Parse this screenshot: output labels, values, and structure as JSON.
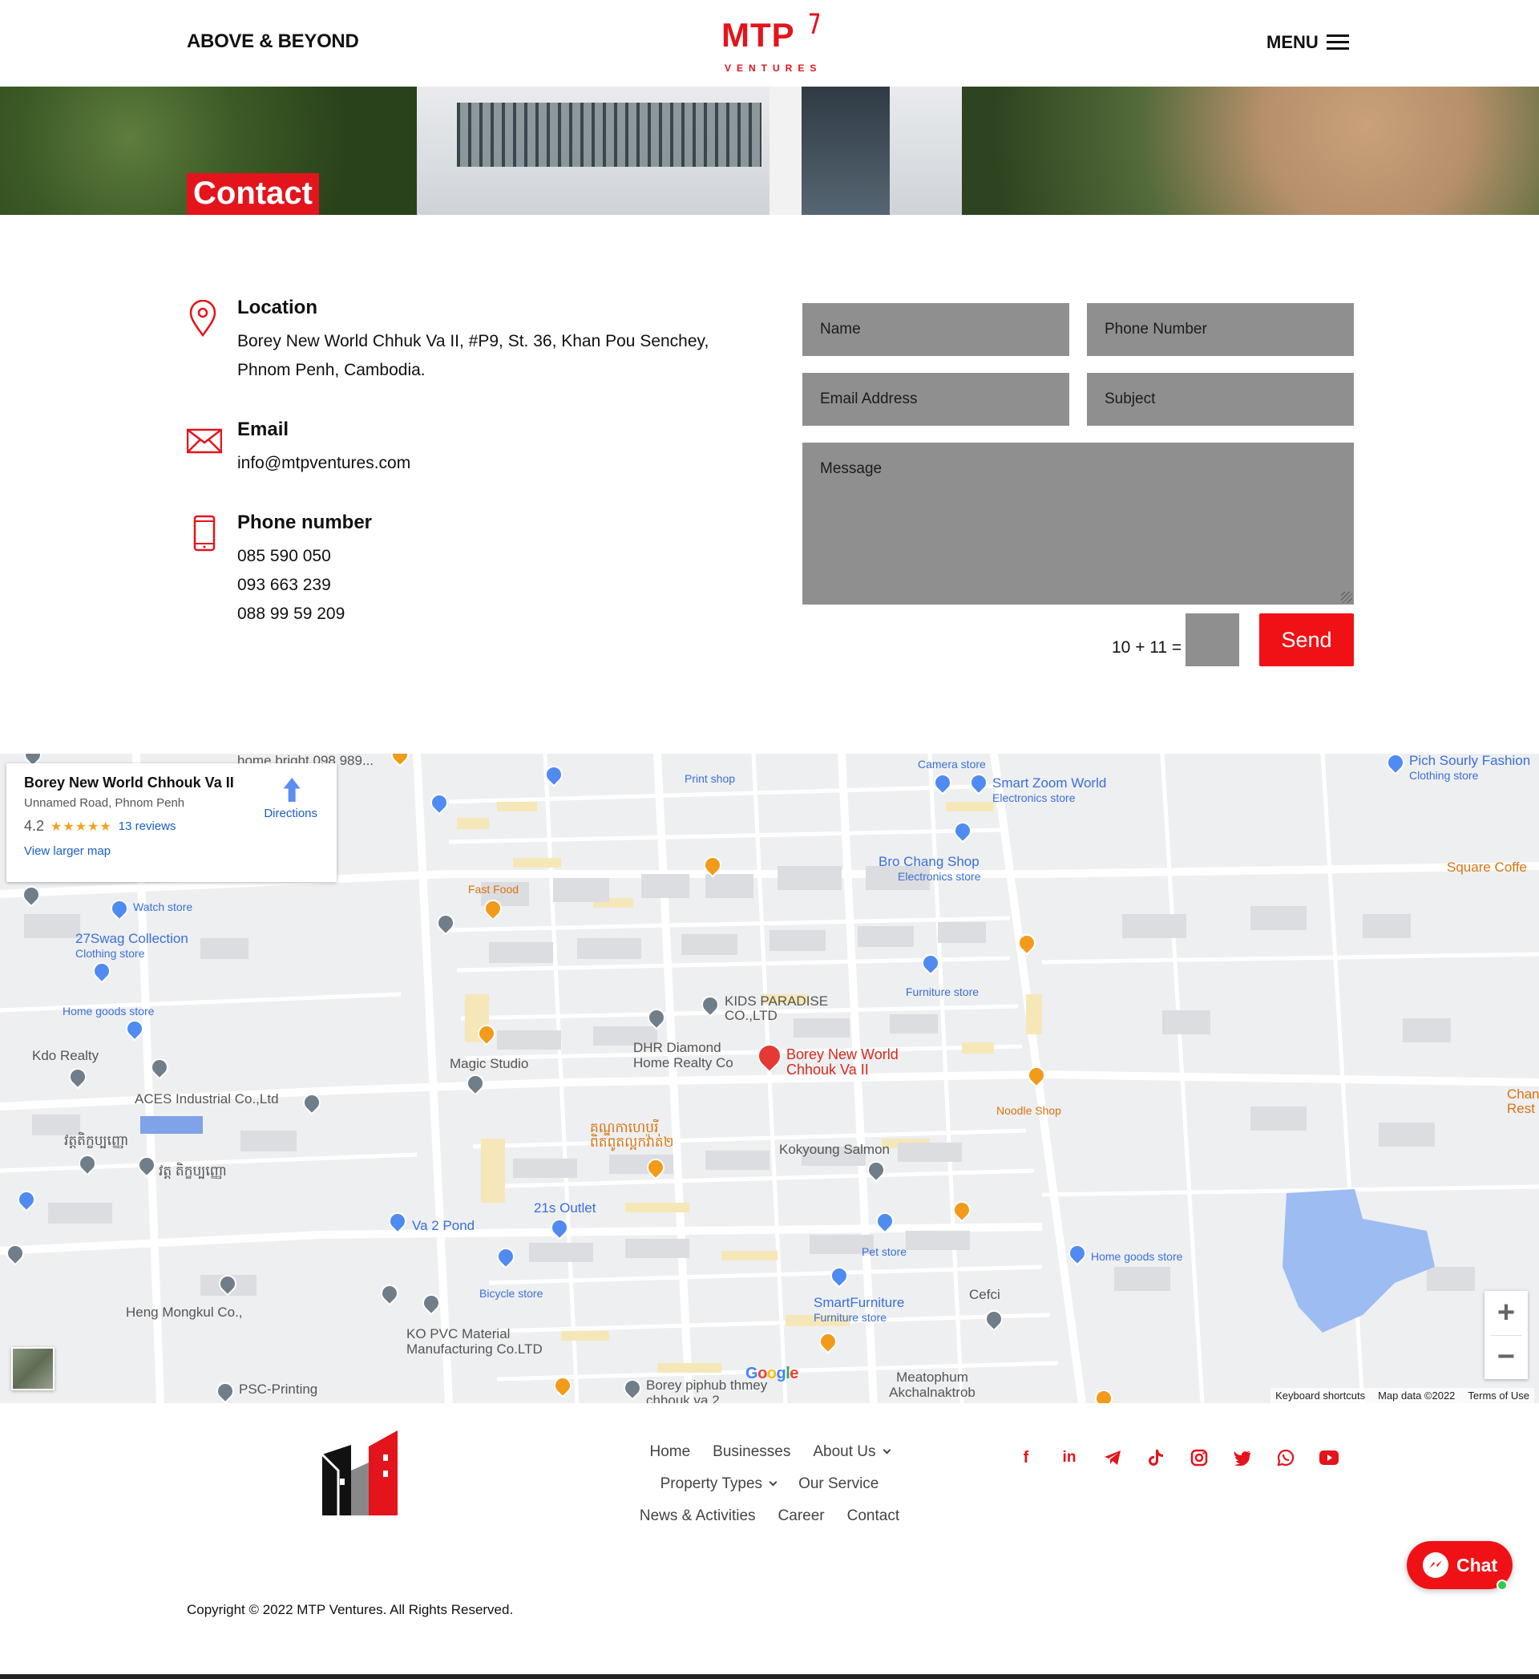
{
  "header": {
    "tagline": "ABOVE & BEYOND",
    "logo_text": "MTP",
    "logo_sub": "VENTURES",
    "menu_label": "MENU"
  },
  "hero": {
    "title": "Contact"
  },
  "contact": {
    "location": {
      "heading": "Location",
      "line1": "Borey New World Chhuk Va II, #P9, St. 36, Khan Pou Senchey,",
      "line2": "Phnom Penh, Cambodia."
    },
    "email": {
      "heading": "Email",
      "value": "info@mtpventures.com"
    },
    "phone": {
      "heading": "Phone number",
      "numbers": [
        "085 590 050",
        "093 663 239",
        "088 99 59 209"
      ]
    }
  },
  "form": {
    "name_placeholder": "Name",
    "phone_placeholder": "Phone Number",
    "email_placeholder": "Email Address",
    "subject_placeholder": "Subject",
    "message_placeholder": "Message",
    "captcha": "10 + 11 =",
    "send_label": "Send"
  },
  "map": {
    "card": {
      "title": "Borey New World Chhouk Va II",
      "address": "Unnamed Road, Phnom Penh",
      "rating": "4.2",
      "stars": "★★★★★",
      "reviews": "13 reviews",
      "view_larger": "View larger map",
      "directions": "Directions"
    },
    "labels": {
      "home_bright": "home bright 098 989...",
      "print_shop": "Print shop",
      "camera_store": "Camera store",
      "smart_zoom": "Smart Zoom World",
      "electronics1": "Electronics store",
      "pich_sourly": "Pich Sourly Fashion",
      "clothing1": "Clothing store",
      "square_coffee": "Square Coffe",
      "bro_chang": "Bro Chang Shop",
      "electronics2": "Electronics store",
      "fast_food": "Fast Food",
      "watch_store": "Watch store",
      "swag": "27Swag Collection",
      "clothing2": "Clothing store",
      "home_goods1": "Home goods store",
      "kids_paradise": "KIDS PARADISE CO.,LTD",
      "furniture_store": "Furniture store",
      "kdo": "Kdo Realty",
      "dhr": "DHR Diamond Home Realty Co",
      "borey_pin": "Borey New World Chhouk Va II",
      "magic": "Magic Studio",
      "aces": "ACES Industrial Co.,Ltd",
      "noodle": "Noodle Shop",
      "chan": "Chan Rest",
      "khmer1": "វត្តតិក្ខប្បញ្ញោ",
      "khmer2": "វត្ត តិក្ខប្បញ្ញោ",
      "khmer3": "គណ្ឌកាហេបរី ពិតពូតល្អកវ៉ាត់២",
      "kokyoung": "Kokyoung Salmon",
      "va2pond": "Va 2 Pond",
      "outlet": "21s Outlet",
      "pet": "Pet store",
      "home_goods2": "Home goods store",
      "bicycle": "Bicycle store",
      "smartfurniture": "SmartFurniture",
      "furniture2": "Furniture store",
      "cefci": "Cefci",
      "heng": "Heng Mongkul Co.,",
      "ko_pvc": "KO PVC Material Manufacturing Co.LTD",
      "psc": "PSC-Printing",
      "borey_piphub": "Borey piphub thmey chhouk va 2",
      "meatophum": "Meatophum Akchalnaktrob",
      "google": "Google"
    },
    "footer_links": [
      "Keyboard shortcuts",
      "Map data ©2022",
      "Terms of Use"
    ],
    "zoom_in": "+",
    "zoom_out": "−"
  },
  "footer": {
    "nav_row1": [
      "Home",
      "Businesses",
      "About Us"
    ],
    "nav_row2": [
      "Property Types",
      "Our Service"
    ],
    "nav_row3": [
      "News & Activities",
      "Career",
      "Contact"
    ],
    "social": [
      "facebook-icon",
      "linkedin-icon",
      "telegram-icon",
      "tiktok-icon",
      "instagram-icon",
      "twitter-icon",
      "whatsapp-icon",
      "youtube-icon"
    ],
    "copyright": "Copyright © 2022 MTP Ventures. All Rights Reserved.",
    "chat_label": "Chat"
  },
  "colors": {
    "brand_red": "#e3141c",
    "field_grey": "#8f8f8f"
  }
}
